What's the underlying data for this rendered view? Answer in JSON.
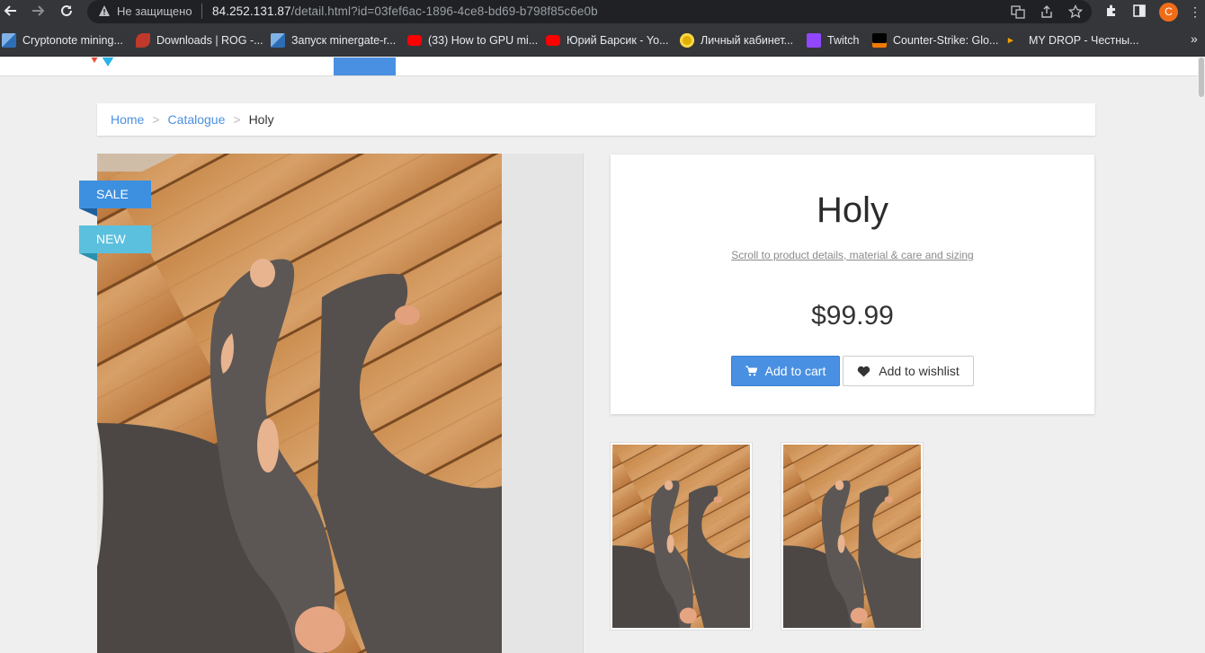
{
  "browser": {
    "insecure_label": "Не защищено",
    "url_host": "84.252.131.87",
    "url_path": "/detail.html?id=03fef6ac-1896-4ce8-bd69-b798f85c6e0b",
    "profile_initial": "C"
  },
  "bookmarks": [
    {
      "label": "Cryptonote mining...",
      "color": "#2d6db5"
    },
    {
      "label": "Downloads | ROG -...",
      "color": "#c0392b"
    },
    {
      "label": "Запуск minergate-r...",
      "color": "#2d6db5"
    },
    {
      "label": "(33) How to GPU mi...",
      "color": "#ff0000"
    },
    {
      "label": "Юрий Барсик - Yo...",
      "color": "#ff0000"
    },
    {
      "label": "Личный кабинет...",
      "color": "#e0b000"
    },
    {
      "label": "Twitch",
      "color": "#9146ff"
    },
    {
      "label": "Counter-Strike: Glo...",
      "color": "#000000"
    },
    {
      "label": "MY DROP - Честны...",
      "color": "#f0a000"
    }
  ],
  "breadcrumb": {
    "home": "Home",
    "separator": ">",
    "catalogue": "Catalogue",
    "current": "Holy"
  },
  "badges": {
    "sale": "SALE",
    "new": "NEW"
  },
  "product": {
    "title": "Holy",
    "scroll_link": "Scroll to product details, material & care and sizing",
    "price": "$99.99",
    "add_to_cart": "Add to cart",
    "add_to_wishlist": "Add to wishlist"
  },
  "colors": {
    "accent": "#4a90e2",
    "sale_badge": "#3d8fe0",
    "new_badge": "#5bc0de"
  }
}
